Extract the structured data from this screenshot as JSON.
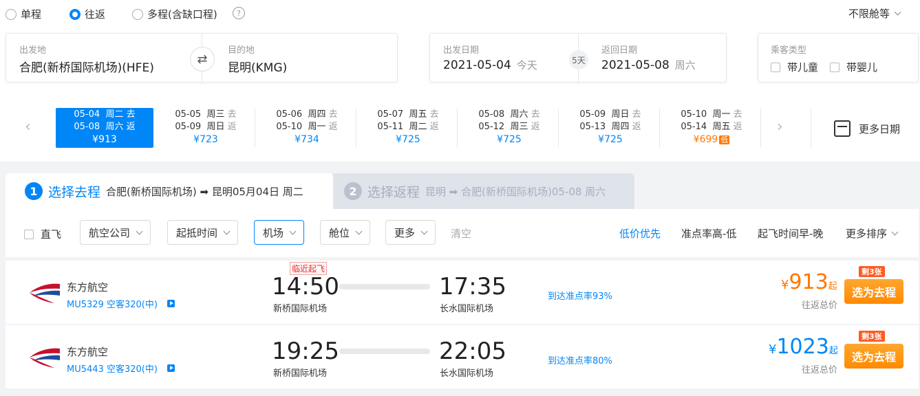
{
  "trip_types": [
    {
      "label": "单程",
      "selected": false
    },
    {
      "label": "往返",
      "selected": true
    },
    {
      "label": "多程(含缺口程)",
      "selected": false
    }
  ],
  "help_glyph": "?",
  "cabin_label": "不限舱等",
  "search": {
    "from_label": "出发地",
    "from_value": "合肥(新桥国际机场)(HFE)",
    "to_label": "目的地",
    "to_value": "昆明(KMG)",
    "swap_glyph": "⇄",
    "depart_label": "出发日期",
    "depart_date": "2021-05-04",
    "depart_note": "今天",
    "days_between": "5天",
    "return_label": "返回日期",
    "return_date": "2021-05-08",
    "return_note": "周六",
    "pax_label": "乘客类型",
    "with_child": "带儿童",
    "with_infant": "带婴儿"
  },
  "date_strip": [
    {
      "go": "05-04",
      "go_day": "周二",
      "go_tag": "去",
      "back": "05-08",
      "back_day": "周六",
      "back_tag": "返",
      "price": "¥913",
      "selected": true,
      "low": false
    },
    {
      "go": "05-05",
      "go_day": "周三",
      "go_tag": "去",
      "back": "05-09",
      "back_day": "周日",
      "back_tag": "返",
      "price": "¥723",
      "selected": false,
      "low": false
    },
    {
      "go": "05-06",
      "go_day": "周四",
      "go_tag": "去",
      "back": "05-10",
      "back_day": "周一",
      "back_tag": "返",
      "price": "¥734",
      "selected": false,
      "low": false
    },
    {
      "go": "05-07",
      "go_day": "周五",
      "go_tag": "去",
      "back": "05-11",
      "back_day": "周二",
      "back_tag": "返",
      "price": "¥725",
      "selected": false,
      "low": false
    },
    {
      "go": "05-08",
      "go_day": "周六",
      "go_tag": "去",
      "back": "05-12",
      "back_day": "周三",
      "back_tag": "返",
      "price": "¥725",
      "selected": false,
      "low": false
    },
    {
      "go": "05-09",
      "go_day": "周日",
      "go_tag": "去",
      "back": "05-13",
      "back_day": "周四",
      "back_tag": "返",
      "price": "¥725",
      "selected": false,
      "low": false
    },
    {
      "go": "05-10",
      "go_day": "周一",
      "go_tag": "去",
      "back": "05-14",
      "back_day": "周五",
      "back_tag": "返",
      "price": "¥699",
      "selected": false,
      "low": true,
      "low_tag": "低"
    }
  ],
  "more_dates": "更多日期",
  "steps": {
    "one_num": "1",
    "one_title": "选择去程",
    "one_route": "合肥(新桥国际机场) ➡ 昆明05月04日 周二",
    "two_num": "2",
    "two_title": "选择返程",
    "two_route": "昆明 ➡ 合肥(新桥国际机场)05-08 周六"
  },
  "filters": {
    "direct": "直飞",
    "airline": "航空公司",
    "time": "起抵时间",
    "airport": "机场",
    "cabin": "舱位",
    "more": "更多",
    "clear": "清空",
    "sort_low": "低价优先",
    "sort_ontime": "准点率高-低",
    "sort_depart": "起飞时间早-晚",
    "sort_more": "更多排序"
  },
  "flights": [
    {
      "airline": "东方航空",
      "flight_no": "MU5329 空客320(中)",
      "tag": "临近起飞",
      "dep_time": "14:50",
      "dep_airport": "新桥国际机场",
      "arr_time": "17:35",
      "arr_airport": "长水国际机场",
      "ontime": "到达准点率93%",
      "yuan": "¥",
      "price": "913",
      "qi": "起",
      "total_label": "往返总价",
      "left": "剩3张",
      "select": "选为去程",
      "price_color": "orange"
    },
    {
      "airline": "东方航空",
      "flight_no": "MU5443 空客320(中)",
      "tag": "",
      "dep_time": "19:25",
      "dep_airport": "新桥国际机场",
      "arr_time": "22:05",
      "arr_airport": "长水国际机场",
      "ontime": "到达准点率80%",
      "yuan": "¥",
      "price": "1023",
      "qi": "起",
      "total_label": "往返总价",
      "left": "剩3张",
      "select": "选为去程",
      "price_color": "blue"
    }
  ],
  "colors": {
    "accent": "#0086f6",
    "orange": "#ff7700",
    "select_btn": "#ff8a00"
  }
}
